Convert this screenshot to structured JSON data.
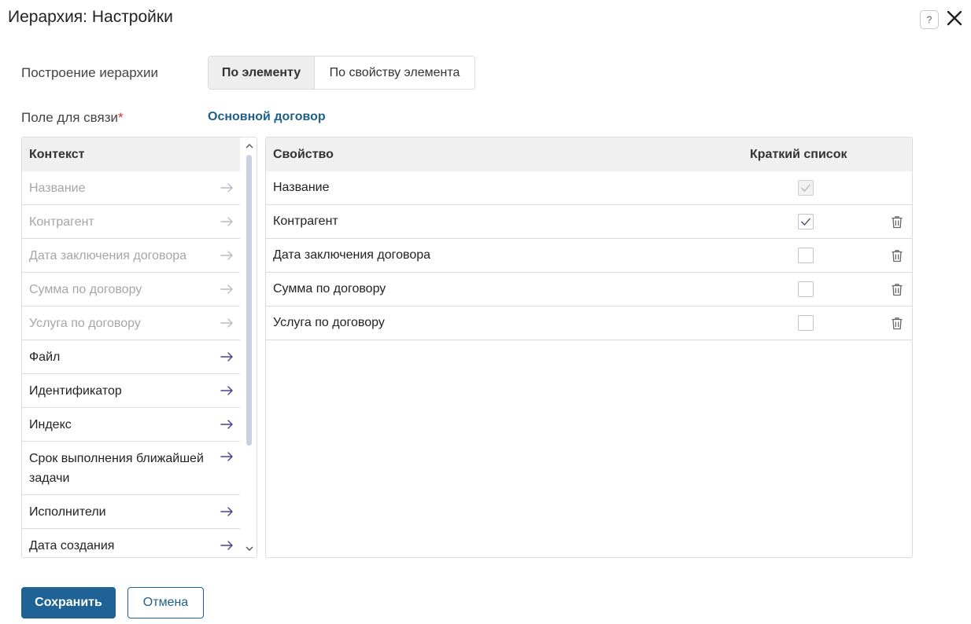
{
  "window": {
    "title": "Иерархия: Настройки",
    "help_glyph": "?"
  },
  "hierarchy_build": {
    "label": "Построение иерархии",
    "options": [
      "По элементу",
      "По свойству элемента"
    ],
    "selected": "По элементу"
  },
  "link_field": {
    "label": "Поле для связи",
    "required_mark": "*",
    "value": "Основной договор"
  },
  "context_panel": {
    "header": "Контекст",
    "items": [
      {
        "label": "Название",
        "disabled": true
      },
      {
        "label": "Контрагент",
        "disabled": true
      },
      {
        "label": "Дата заключения договора",
        "disabled": true
      },
      {
        "label": "Сумма по договору",
        "disabled": true
      },
      {
        "label": "Услуга по договору",
        "disabled": true
      },
      {
        "label": "Файл",
        "disabled": false
      },
      {
        "label": "Идентификатор",
        "disabled": false
      },
      {
        "label": "Индекс",
        "disabled": false
      },
      {
        "label": "Срок выполнения ближайшей задачи",
        "disabled": false
      },
      {
        "label": "Исполнители",
        "disabled": false
      },
      {
        "label": "Дата создания",
        "disabled": false
      }
    ]
  },
  "properties_panel": {
    "header_property": "Свойство",
    "header_short_list": "Краткий список",
    "rows": [
      {
        "label": "Название",
        "short_list": true,
        "locked": true
      },
      {
        "label": "Контрагент",
        "short_list": true,
        "locked": false
      },
      {
        "label": "Дата заключения договора",
        "short_list": false,
        "locked": false
      },
      {
        "label": "Сумма по договору",
        "short_list": false,
        "locked": false
      },
      {
        "label": "Услуга по договору",
        "short_list": false,
        "locked": false
      }
    ]
  },
  "footer": {
    "save_label": "Сохранить",
    "cancel_label": "Отмена"
  },
  "colors": {
    "accent": "#1f6296",
    "link": "#1f5f8b",
    "required": "#d0302f",
    "disabled_text": "#a6a6a6",
    "header_bg": "#f0f0f0",
    "arrow": "#4a3f8f"
  },
  "icons": {
    "help": "help-icon",
    "close": "close-icon",
    "arrow": "arrow-right-icon",
    "trash": "trash-icon",
    "check": "check-icon",
    "scroll_up": "chevron-up-icon",
    "scroll_down": "chevron-down-icon"
  }
}
